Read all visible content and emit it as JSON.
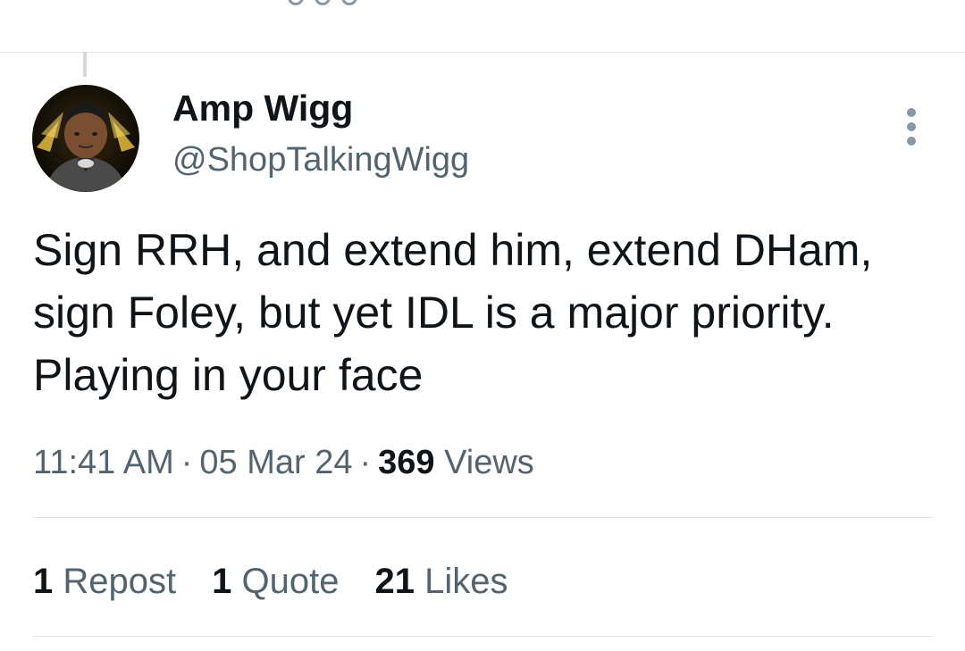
{
  "author": {
    "display_name": "Amp Wigg",
    "handle": "@ShopTalkingWigg",
    "avatar_icon": "profile-avatar"
  },
  "tweet": {
    "text": "Sign RRH, and extend him, extend DHam, sign Foley, but yet IDL is a major priority. Playing in your face",
    "time": "11:41 AM",
    "date": "05 Mar 24",
    "views_count": "369",
    "views_label": "Views",
    "separator": "·"
  },
  "stats": {
    "reposts_count": "1",
    "reposts_label": "Repost",
    "quotes_count": "1",
    "quotes_label": "Quote",
    "likes_count": "21",
    "likes_label": "Likes"
  },
  "icons": {
    "more": "more-vertical-icon"
  },
  "colors": {
    "text_primary": "#0f1419",
    "text_secondary": "#536471",
    "divider": "#dfe4e8"
  }
}
